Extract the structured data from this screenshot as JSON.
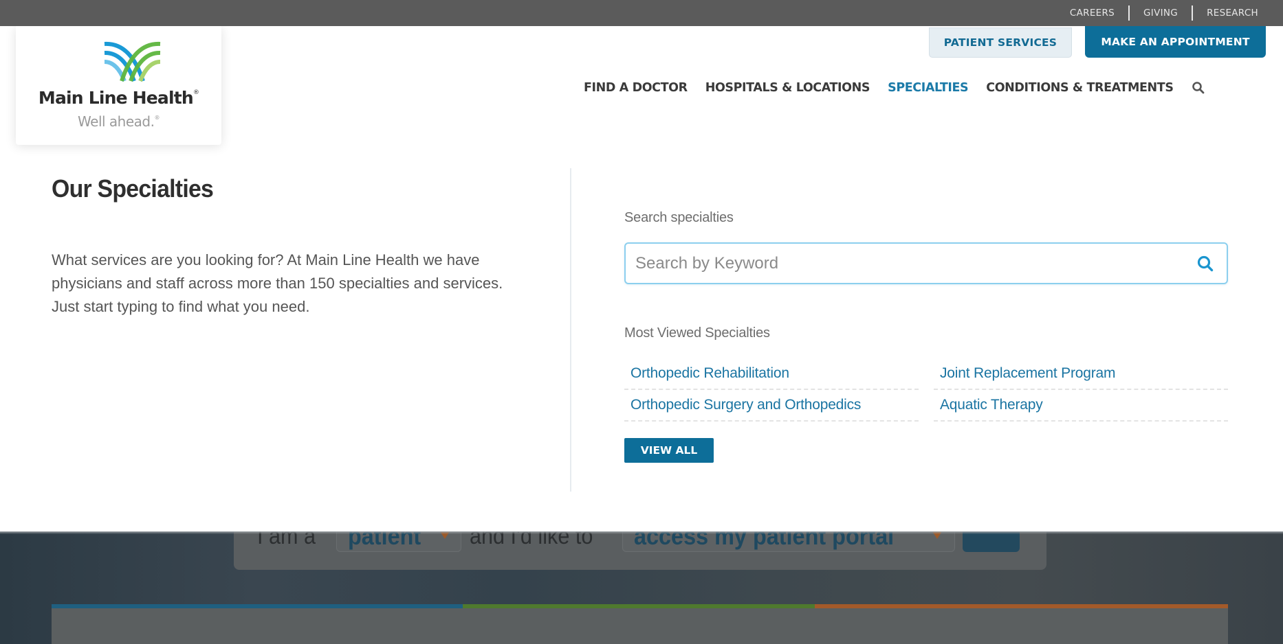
{
  "utility_nav": {
    "links": [
      "CAREERS",
      "GIVING",
      "RESEARCH"
    ]
  },
  "logo": {
    "name": "Main Line Health",
    "registered": "®",
    "tagline": "Well ahead.",
    "tagline_mark": "®",
    "colors": {
      "blue": "#1a9ad6",
      "light_blue": "#6cc3ea",
      "green": "#5db53d",
      "light_green": "#a8d36b"
    }
  },
  "header_buttons": {
    "patient_services": "PATIENT SERVICES",
    "make_appointment": "MAKE AN APPOINTMENT"
  },
  "main_nav": {
    "items": [
      {
        "label": "FIND A DOCTOR",
        "active": false
      },
      {
        "label": "HOSPITALS & LOCATIONS",
        "active": false
      },
      {
        "label": "SPECIALTIES",
        "active": true
      },
      {
        "label": "CONDITIONS & TREATMENTS",
        "active": false
      }
    ],
    "search_icon": "search-icon"
  },
  "specialties_dropdown": {
    "title": "Our Specialties",
    "description": "What services are you looking for? At Main Line Health we have physicians and staff across more than 150 specialties and services. Just start typing to find what you need.",
    "search_label": "Search specialties",
    "search_placeholder": "Search by Keyword",
    "search_value": "",
    "most_viewed_label": "Most Viewed Specialties",
    "most_viewed": [
      "Orthopedic Rehabilitation",
      "Joint Replacement Program",
      "Orthopedic Surgery and Orthopedics",
      "Aquatic Therapy"
    ],
    "view_all_label": "VIEW ALL"
  },
  "hero_background": {
    "prefix": "I am a",
    "role_value": "patient",
    "middle": "and I'd like to",
    "action_value": "access my patient portal",
    "stripe_colors": [
      "#1f5f80",
      "#4f7a2e",
      "#a35a2a"
    ]
  },
  "colors": {
    "brand_blue": "#0d6e99",
    "link_blue": "#1a74a2",
    "utility_bar": "#5b5b5b"
  }
}
